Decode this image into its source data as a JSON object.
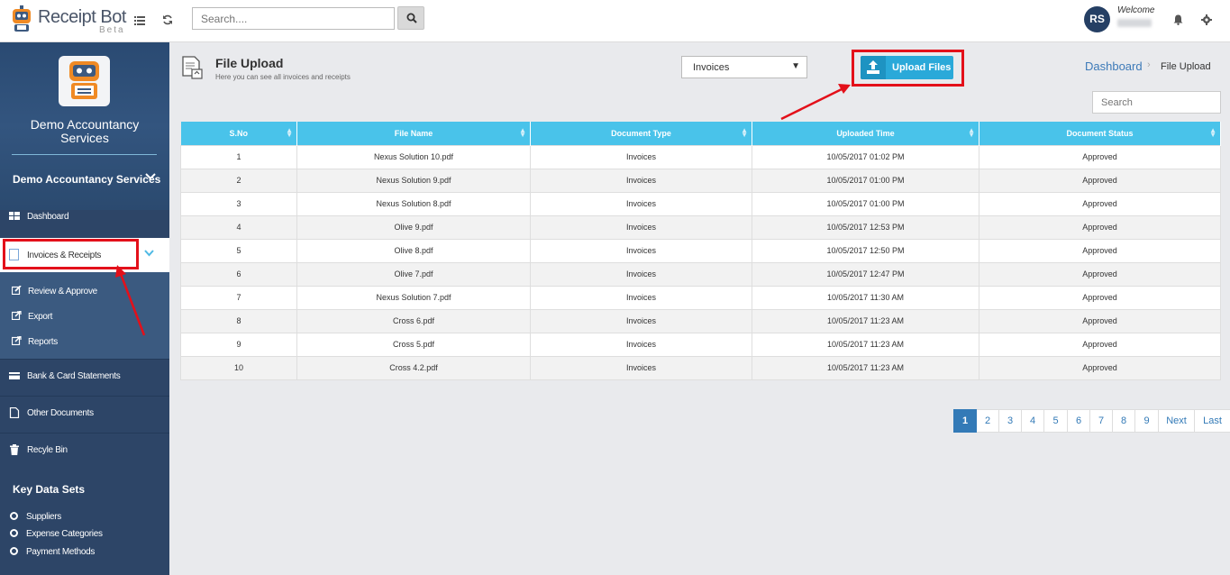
{
  "app": {
    "brand": "Receipt Bot",
    "beta": "Beta",
    "search_placeholder": "Search....",
    "user_initials": "RS",
    "welcome": "Welcome"
  },
  "sidebar": {
    "company": "Demo Accountancy Services",
    "dropdown_label": "Demo Accountancy Services",
    "items": {
      "dashboard": "Dashboard",
      "invoices": "Invoices & Receipts",
      "review": "Review & Approve",
      "export": "Export",
      "reports": "Reports",
      "bank": "Bank & Card Statements",
      "other": "Other Documents",
      "recycle": "Recyle Bin"
    },
    "key_data_title": "Key Data Sets",
    "key_data": [
      "Suppliers",
      "Expense Categories",
      "Payment Methods"
    ]
  },
  "page": {
    "title": "File Upload",
    "subtitle": "Here you can see all invoices and receipts",
    "doc_type_selected": "Invoices",
    "upload_label": "Upload Files",
    "breadcrumb_link": "Dashboard",
    "breadcrumb_current": "File Upload",
    "table_search_placeholder": "Search"
  },
  "table": {
    "columns": [
      "S.No",
      "File Name",
      "Document Type",
      "Uploaded Time",
      "Document Status"
    ],
    "rows": [
      [
        "1",
        "Nexus Solution 10.pdf",
        "Invoices",
        "10/05/2017 01:02 PM",
        "Approved"
      ],
      [
        "2",
        "Nexus Solution 9.pdf",
        "Invoices",
        "10/05/2017 01:00 PM",
        "Approved"
      ],
      [
        "3",
        "Nexus Solution 8.pdf",
        "Invoices",
        "10/05/2017 01:00 PM",
        "Approved"
      ],
      [
        "4",
        "Olive 9.pdf",
        "Invoices",
        "10/05/2017 12:53 PM",
        "Approved"
      ],
      [
        "5",
        "Olive 8.pdf",
        "Invoices",
        "10/05/2017 12:50 PM",
        "Approved"
      ],
      [
        "6",
        "Olive 7.pdf",
        "Invoices",
        "10/05/2017 12:47 PM",
        "Approved"
      ],
      [
        "7",
        "Nexus Solution 7.pdf",
        "Invoices",
        "10/05/2017 11:30 AM",
        "Approved"
      ],
      [
        "8",
        "Cross 6.pdf",
        "Invoices",
        "10/05/2017 11:23 AM",
        "Approved"
      ],
      [
        "9",
        "Cross 5.pdf",
        "Invoices",
        "10/05/2017 11:23 AM",
        "Approved"
      ],
      [
        "10",
        "Cross 4.2.pdf",
        "Invoices",
        "10/05/2017 11:23 AM",
        "Approved"
      ]
    ]
  },
  "pagination": {
    "pages": [
      "1",
      "2",
      "3",
      "4",
      "5",
      "6",
      "7",
      "8",
      "9"
    ],
    "current": "1",
    "next": "Next",
    "last": "Last"
  },
  "colors": {
    "header_blue": "#49c3ea",
    "sidebar_navy": "#2d4567",
    "accent_red": "#e3101a",
    "upload_blue": "#2aa9d9"
  }
}
